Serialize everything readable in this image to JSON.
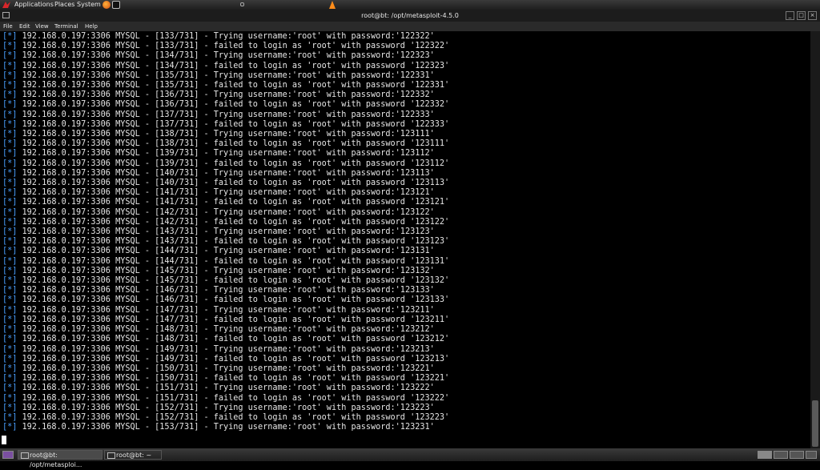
{
  "panel": {
    "menus": [
      "Applications",
      "Places",
      "System"
    ]
  },
  "window": {
    "title": "root@bt: /opt/metasploit-4.5.0",
    "menubar": [
      "File",
      "Edit",
      "View",
      "Terminal",
      "Help"
    ]
  },
  "terminal": {
    "prefix": "[*]",
    "lines": [
      " 192.168.0.197:3306 MYSQL - [133/731] - Trying username:'root' with password:'122322'",
      " 192.168.0.197:3306 MYSQL - [133/731] - failed to login as 'root' with password '122322'",
      " 192.168.0.197:3306 MYSQL - [134/731] - Trying username:'root' with password:'122323'",
      " 192.168.0.197:3306 MYSQL - [134/731] - failed to login as 'root' with password '122323'",
      " 192.168.0.197:3306 MYSQL - [135/731] - Trying username:'root' with password:'122331'",
      " 192.168.0.197:3306 MYSQL - [135/731] - failed to login as 'root' with password '122331'",
      " 192.168.0.197:3306 MYSQL - [136/731] - Trying username:'root' with password:'122332'",
      " 192.168.0.197:3306 MYSQL - [136/731] - failed to login as 'root' with password '122332'",
      " 192.168.0.197:3306 MYSQL - [137/731] - Trying username:'root' with password:'122333'",
      " 192.168.0.197:3306 MYSQL - [137/731] - failed to login as 'root' with password '122333'",
      " 192.168.0.197:3306 MYSQL - [138/731] - Trying username:'root' with password:'123111'",
      " 192.168.0.197:3306 MYSQL - [138/731] - failed to login as 'root' with password '123111'",
      " 192.168.0.197:3306 MYSQL - [139/731] - Trying username:'root' with password:'123112'",
      " 192.168.0.197:3306 MYSQL - [139/731] - failed to login as 'root' with password '123112'",
      " 192.168.0.197:3306 MYSQL - [140/731] - Trying username:'root' with password:'123113'",
      " 192.168.0.197:3306 MYSQL - [140/731] - failed to login as 'root' with password '123113'",
      " 192.168.0.197:3306 MYSQL - [141/731] - Trying username:'root' with password:'123121'",
      " 192.168.0.197:3306 MYSQL - [141/731] - failed to login as 'root' with password '123121'",
      " 192.168.0.197:3306 MYSQL - [142/731] - Trying username:'root' with password:'123122'",
      " 192.168.0.197:3306 MYSQL - [142/731] - failed to login as 'root' with password '123122'",
      " 192.168.0.197:3306 MYSQL - [143/731] - Trying username:'root' with password:'123123'",
      " 192.168.0.197:3306 MYSQL - [143/731] - failed to login as 'root' with password '123123'",
      " 192.168.0.197:3306 MYSQL - [144/731] - Trying username:'root' with password:'123131'",
      " 192.168.0.197:3306 MYSQL - [144/731] - failed to login as 'root' with password '123131'",
      " 192.168.0.197:3306 MYSQL - [145/731] - Trying username:'root' with password:'123132'",
      " 192.168.0.197:3306 MYSQL - [145/731] - failed to login as 'root' with password '123132'",
      " 192.168.0.197:3306 MYSQL - [146/731] - Trying username:'root' with password:'123133'",
      " 192.168.0.197:3306 MYSQL - [146/731] - failed to login as 'root' with password '123133'",
      " 192.168.0.197:3306 MYSQL - [147/731] - Trying username:'root' with password:'123211'",
      " 192.168.0.197:3306 MYSQL - [147/731] - failed to login as 'root' with password '123211'",
      " 192.168.0.197:3306 MYSQL - [148/731] - Trying username:'root' with password:'123212'",
      " 192.168.0.197:3306 MYSQL - [148/731] - failed to login as 'root' with password '123212'",
      " 192.168.0.197:3306 MYSQL - [149/731] - Trying username:'root' with password:'123213'",
      " 192.168.0.197:3306 MYSQL - [149/731] - failed to login as 'root' with password '123213'",
      " 192.168.0.197:3306 MYSQL - [150/731] - Trying username:'root' with password:'123221'",
      " 192.168.0.197:3306 MYSQL - [150/731] - failed to login as 'root' with password '123221'",
      " 192.168.0.197:3306 MYSQL - [151/731] - Trying username:'root' with password:'123222'",
      " 192.168.0.197:3306 MYSQL - [151/731] - failed to login as 'root' with password '123222'",
      " 192.168.0.197:3306 MYSQL - [152/731] - Trying username:'root' with password:'123223'",
      " 192.168.0.197:3306 MYSQL - [152/731] - failed to login as 'root' with password '123223'",
      " 192.168.0.197:3306 MYSQL - [153/731] - Trying username:'root' with password:'123231'"
    ]
  },
  "taskbar": {
    "tasks": [
      "root@bt: /opt/metasploi...",
      "root@bt: ~"
    ]
  },
  "colors": {
    "terminal_bg": "#000000",
    "terminal_fg": "#e6e6e6",
    "status_marker": "#4aa0ff"
  }
}
